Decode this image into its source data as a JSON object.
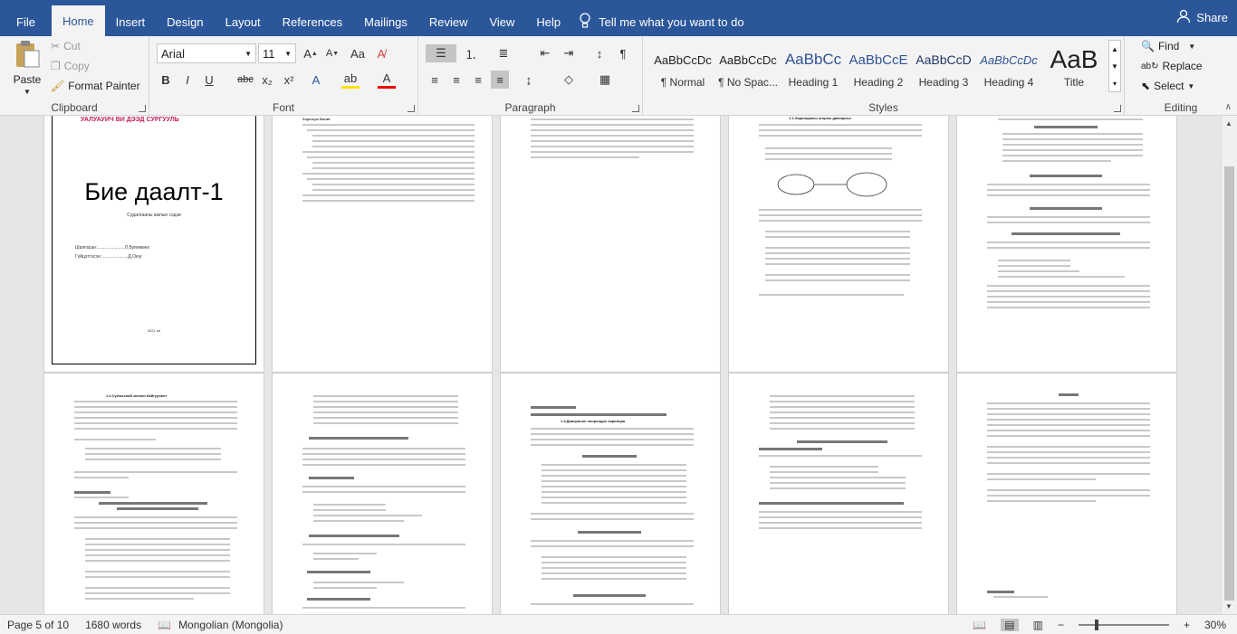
{
  "menu": {
    "file": "File",
    "tabs": [
      "Home",
      "Insert",
      "Design",
      "Layout",
      "References",
      "Mailings",
      "Review",
      "View",
      "Help"
    ],
    "tell_me": "Tell me what you want to do",
    "share": "Share"
  },
  "clipboard": {
    "paste": "Paste",
    "cut": "Cut",
    "copy": "Copy",
    "format_painter": "Format Painter",
    "label": "Clipboard"
  },
  "font": {
    "name": "Arial",
    "size": "11",
    "label": "Font"
  },
  "paragraph": {
    "label": "Paragraph"
  },
  "styles": {
    "label": "Styles",
    "items": [
      {
        "preview": "AaBbCcDc",
        "name": "¶ Normal"
      },
      {
        "preview": "AaBbCcDc",
        "name": "¶ No Spac..."
      },
      {
        "preview": "AaBbCc",
        "name": "Heading 1"
      },
      {
        "preview": "AaBbCcE",
        "name": "Heading 2"
      },
      {
        "preview": "AaBbCcD",
        "name": "Heading 3"
      },
      {
        "preview": "AaBbCcDc",
        "name": "Heading 4"
      },
      {
        "preview": "AaB",
        "name": "Title"
      }
    ]
  },
  "editing": {
    "find": "Find",
    "replace": "Replace",
    "select": "Select",
    "label": "Editing"
  },
  "document": {
    "cover_title": "Бие даалт-1",
    "cover_banner": "УАЛУАУИЧ ВИ ДЭЭД СУРГУУЛЬ",
    "cover_subtitle": "Судалгааны ажлын сэдэв",
    "cover_lines": [
      "Шалгасан:......................Л.Буянмөнх",
      "Гүйцэтгэсэн:.....................Д.Оюу"
    ],
    "cover_year": "2021 он",
    "toc_heading": "Хэрэгцээ Бичиг",
    "page_headings": [
      "1.1.Харилцааны онцлох давхаргыг",
      "1.2.Сүлжээний зохион байгуулалт",
      "1.3.Давхрагын хоорондох харилцаа"
    ]
  },
  "status": {
    "page": "Page 5 of 10",
    "words": "1680 words",
    "language": "Mongolian (Mongolia)",
    "zoom": "30%"
  }
}
